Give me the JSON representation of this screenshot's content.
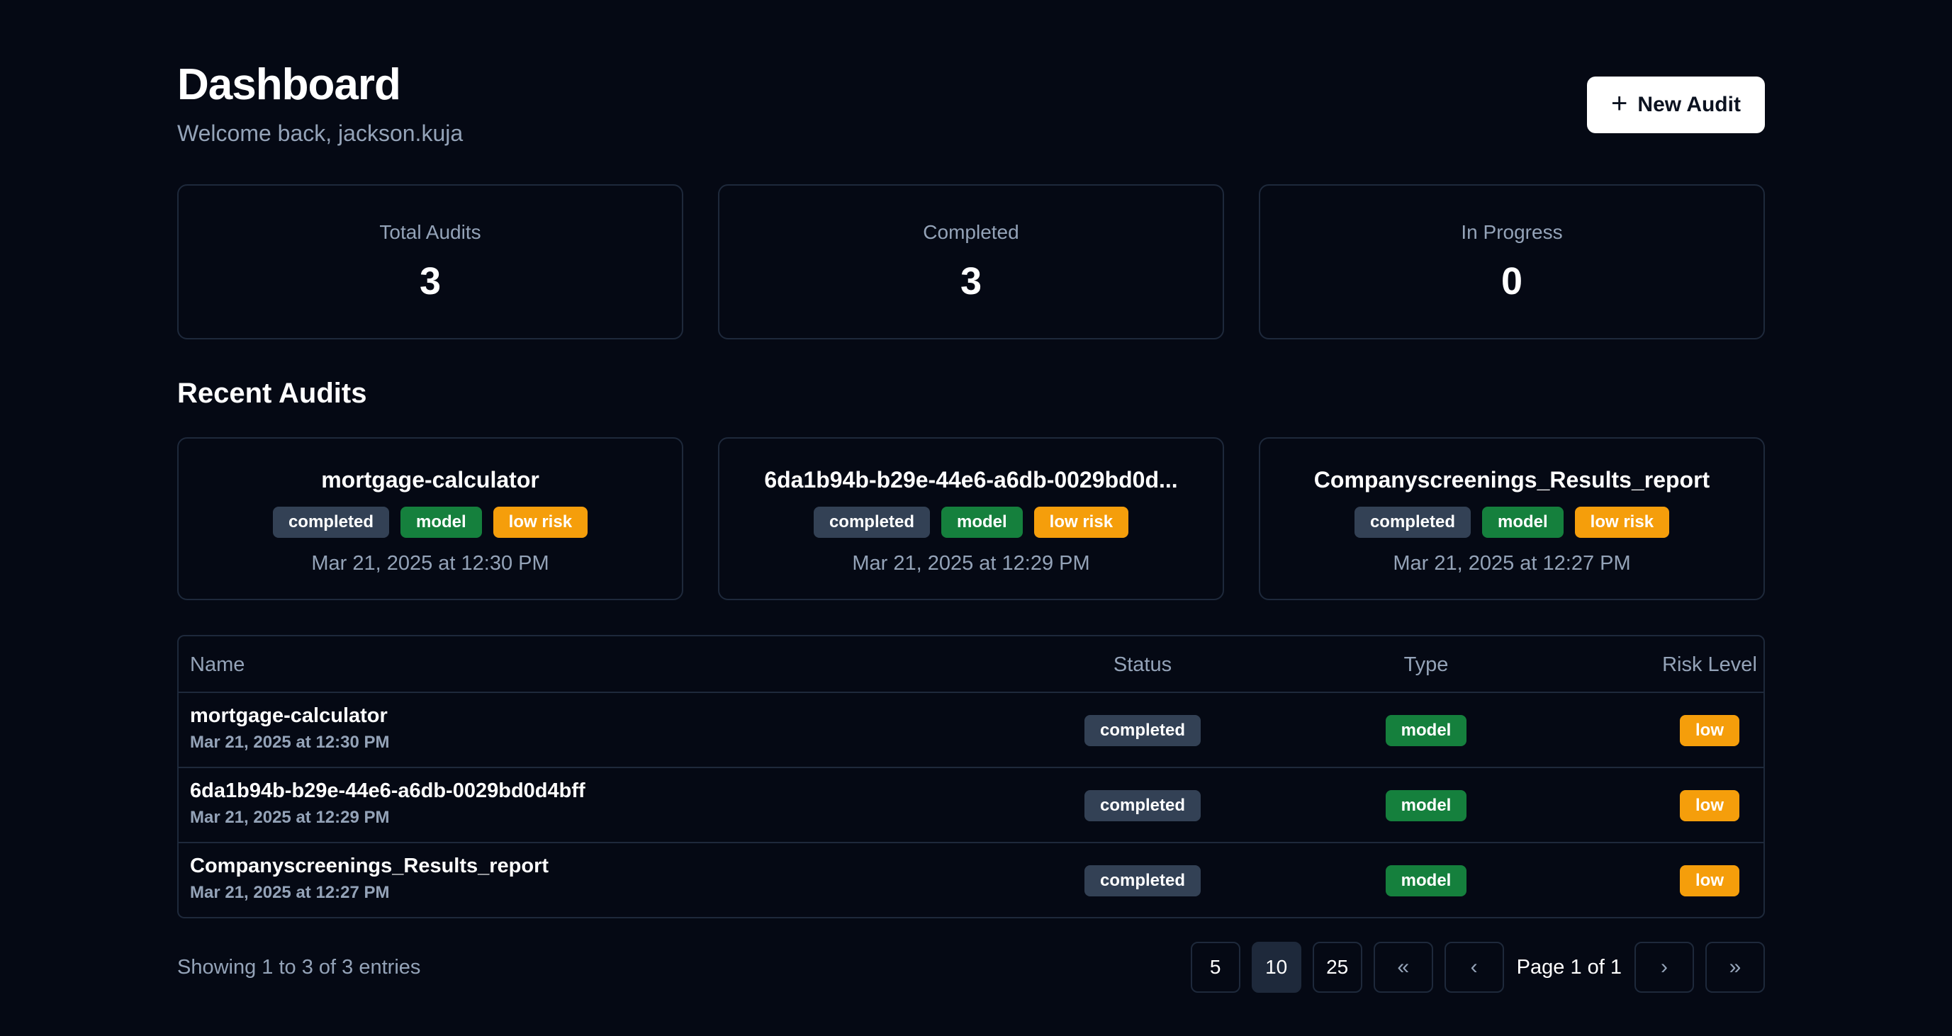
{
  "header": {
    "title": "Dashboard",
    "subtitle": "Welcome back, jackson.kuja",
    "new_audit_label": "New Audit",
    "new_audit_icon": "plus-icon"
  },
  "stats": [
    {
      "label": "Total Audits",
      "value": "3"
    },
    {
      "label": "Completed",
      "value": "3"
    },
    {
      "label": "In Progress",
      "value": "0"
    }
  ],
  "recent": {
    "title": "Recent Audits",
    "cards": [
      {
        "name": "mortgage-calculator",
        "status": "completed",
        "type": "model",
        "risk": "low risk",
        "date": "Mar 21, 2025 at 12:30 PM"
      },
      {
        "name": "6da1b94b-b29e-44e6-a6db-0029bd0d...",
        "status": "completed",
        "type": "model",
        "risk": "low risk",
        "date": "Mar 21, 2025 at 12:29 PM"
      },
      {
        "name": "Companyscreenings_Results_report",
        "status": "completed",
        "type": "model",
        "risk": "low risk",
        "date": "Mar 21, 2025 at 12:27 PM"
      }
    ]
  },
  "table": {
    "columns": [
      "Name",
      "Status",
      "Type",
      "Risk Level"
    ],
    "rows": [
      {
        "name": "mortgage-calculator",
        "date": "Mar 21, 2025 at 12:30 PM",
        "status": "completed",
        "type": "model",
        "risk": "low"
      },
      {
        "name": "6da1b94b-b29e-44e6-a6db-0029bd0d4bff",
        "date": "Mar 21, 2025 at 12:29 PM",
        "status": "completed",
        "type": "model",
        "risk": "low"
      },
      {
        "name": "Companyscreenings_Results_report",
        "date": "Mar 21, 2025 at 12:27 PM",
        "status": "completed",
        "type": "model",
        "risk": "low"
      }
    ]
  },
  "footer": {
    "showing": "Showing 1 to 3 of 3 entries",
    "page_sizes": [
      "5",
      "10",
      "25"
    ],
    "selected_page_size": "10",
    "page_info": "Page 1 of 1",
    "first_label": "«",
    "prev_label": "‹",
    "next_label": "›",
    "last_label": "»"
  },
  "colors": {
    "background": "#050914",
    "border": "#1e293b",
    "muted_text": "#94a3b8",
    "status_badge": "#334155",
    "type_badge": "#15803d",
    "risk_badge": "#f59e0b",
    "primary_button": "#ffffff"
  }
}
